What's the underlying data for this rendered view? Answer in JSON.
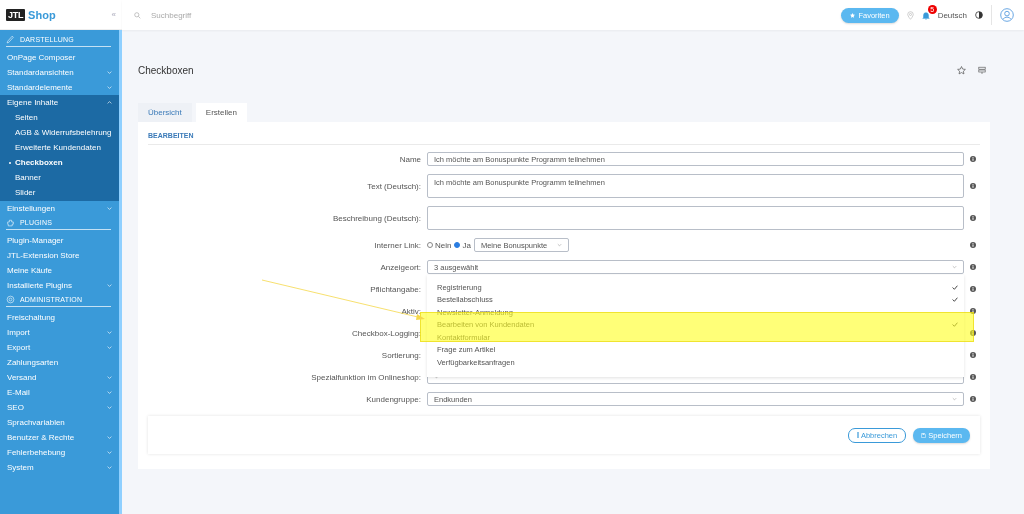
{
  "logo": {
    "mark": "JTL",
    "text": "Shop",
    "collapse": "«"
  },
  "search": {
    "placeholder": "Suchbegriff"
  },
  "topbar": {
    "favorites": "Favoriten",
    "notifications": "5",
    "language": "Deutsch"
  },
  "sidebar": {
    "sections": [
      {
        "title": "DARSTELLUNG",
        "items": [
          {
            "label": "OnPage Composer"
          },
          {
            "label": "Standardansichten",
            "expanded": false
          },
          {
            "label": "Standardelemente",
            "expanded": false
          },
          {
            "label": "Eigene Inhalte",
            "expanded": true,
            "children": [
              {
                "label": "Seiten",
                "selected": false
              },
              {
                "label": "AGB & Widerrufsbelehrung",
                "selected": false
              },
              {
                "label": "Erweiterte Kundendaten",
                "selected": false
              },
              {
                "label": "Checkboxen",
                "selected": true
              },
              {
                "label": "Banner",
                "selected": false
              },
              {
                "label": "Slider",
                "selected": false
              }
            ]
          },
          {
            "label": "Einstellungen",
            "expanded": false
          }
        ]
      },
      {
        "title": "PLUGINS",
        "items": [
          {
            "label": "Plugin-Manager"
          },
          {
            "label": "JTL-Extension Store"
          },
          {
            "label": "Meine Käufe"
          },
          {
            "label": "Installierte Plugins",
            "expanded": false
          }
        ]
      },
      {
        "title": "ADMINISTRATION",
        "items": [
          {
            "label": "Freischaltung"
          },
          {
            "label": "Import",
            "expanded": false
          },
          {
            "label": "Export",
            "expanded": false
          },
          {
            "label": "Zahlungsarten"
          },
          {
            "label": "Versand",
            "expanded": false
          },
          {
            "label": "E-Mail",
            "expanded": false
          },
          {
            "label": "SEO",
            "expanded": false
          },
          {
            "label": "Sprachvariablen"
          },
          {
            "label": "Benutzer & Rechte",
            "expanded": false
          },
          {
            "label": "Fehlerbehebung",
            "expanded": false
          },
          {
            "label": "System",
            "expanded": false
          }
        ]
      }
    ]
  },
  "page": {
    "title": "Checkboxen"
  },
  "tabs": [
    {
      "label": "Übersicht",
      "selected": false
    },
    {
      "label": "Erstellen",
      "selected": true
    }
  ],
  "card": {
    "title": "BEARBEITEN"
  },
  "form": {
    "rows": [
      {
        "label": "Name",
        "kind": "input",
        "value": "Ich möchte am Bonuspunkte Programm teilnehmen"
      },
      {
        "label": "Text (Deutsch):",
        "kind": "textarea",
        "value": "Ich möchte am Bonuspunkte Programm teilnehmen"
      },
      {
        "label": "Beschreibung (Deutsch):",
        "kind": "textarea"
      },
      {
        "label": "Interner Link:",
        "kind": "radio",
        "options": [
          {
            "label": "Nein",
            "selected": false
          },
          {
            "label": "Ja",
            "selected": true
          }
        ],
        "value": "Meine Bonuspunkte"
      },
      {
        "label": "Anzeigeort:",
        "kind": "multiselect",
        "value": "3 ausgewählt",
        "open": true,
        "options": [
          {
            "label": "Registrierung",
            "checked": true,
            "highlighted": false
          },
          {
            "label": "Bestellabschluss",
            "checked": true,
            "highlighted": false
          },
          {
            "label": "Newsletter-Anmeldung",
            "checked": false,
            "highlighted": false
          },
          {
            "label": "Bearbeiten von Kundendaten",
            "checked": true,
            "highlighted": true
          },
          {
            "label": "Kontaktformular",
            "checked": false,
            "highlighted": false
          },
          {
            "label": "Frage zum Artikel",
            "checked": false,
            "highlighted": false
          },
          {
            "label": "Verfügbarkeitsanfragen",
            "checked": false,
            "highlighted": false
          }
        ]
      },
      {
        "label": "Pflichtangabe:",
        "kind": "select"
      },
      {
        "label": "Aktiv:",
        "kind": "select"
      },
      {
        "label": "Checkbox-Logging:",
        "kind": "select"
      },
      {
        "label": "Sortierung:",
        "kind": "input"
      },
      {
        "label": "Spezialfunktion im Onlineshop:",
        "kind": "select"
      },
      {
        "label": "Kundengruppe:",
        "kind": "select",
        "value": "Endkunden"
      }
    ]
  },
  "buttons": [
    {
      "label": "Abbrechen",
      "kind": "secondary"
    },
    {
      "label": "Speichern",
      "kind": "primary"
    }
  ]
}
